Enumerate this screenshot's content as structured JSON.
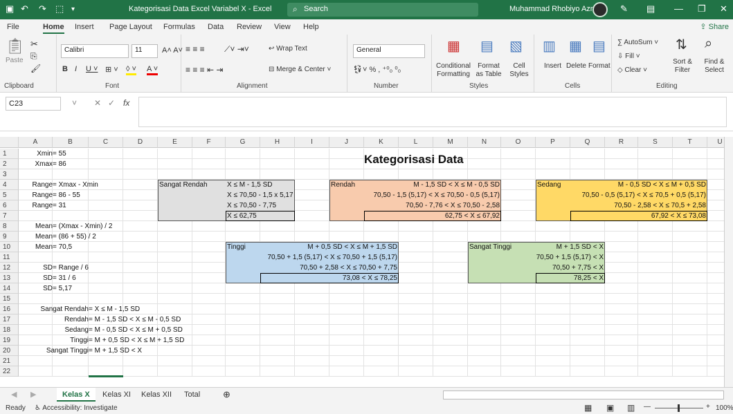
{
  "titlebar": {
    "title": "Kategorisasi Data Excel Variabel X  -  Excel",
    "search_placeholder": "Search",
    "user": "Muhammad Rhobiyo Azmi"
  },
  "menu_tabs": [
    "File",
    "Home",
    "Insert",
    "Page Layout",
    "Formulas",
    "Data",
    "Review",
    "View",
    "Help"
  ],
  "share_label": "Share",
  "ribbon": {
    "clipboard": {
      "label": "Clipboard",
      "paste": "Paste"
    },
    "font": {
      "label": "Font",
      "name": "Calibri",
      "size": "11"
    },
    "alignment": {
      "label": "Alignment",
      "wrap": "Wrap Text",
      "merge": "Merge & Center"
    },
    "number": {
      "label": "Number",
      "format": "General"
    },
    "styles": {
      "label": "Styles",
      "conditional": "Conditional Formatting",
      "format_table": "Format as Table",
      "cell_styles": "Cell Styles"
    },
    "cells": {
      "label": "Cells",
      "insert": "Insert",
      "delete": "Delete",
      "format": "Format"
    },
    "editing": {
      "label": "Editing",
      "autosum": "AutoSum",
      "fill": "Fill",
      "clear": "Clear",
      "sort": "Sort & Filter",
      "find": "Find & Select"
    }
  },
  "name_box": "C23",
  "columns": [
    "A",
    "B",
    "C",
    "D",
    "E",
    "F",
    "G",
    "H",
    "I",
    "J",
    "K",
    "L",
    "M",
    "N",
    "O",
    "P",
    "Q",
    "R",
    "S",
    "T",
    "U"
  ],
  "rows": [
    "1",
    "2",
    "3",
    "4",
    "5",
    "6",
    "7",
    "8",
    "9",
    "10",
    "11",
    "12",
    "13",
    "14",
    "15",
    "16",
    "17",
    "18",
    "19",
    "20",
    "21",
    "22"
  ],
  "cells": {
    "a1": "Xmin = 55",
    "a2": "Xmax = 86",
    "a4": "Range = Xmax - Xmin",
    "a5": "Range = 86 - 55",
    "a6": "Range = 31",
    "a8": "Mean = (Xmax - Xmin) / 2",
    "a9": "Mean = (86 + 55) / 2",
    "a10": "Mean = 70,5",
    "a12": "SD = Range / 6",
    "a13": "SD = 31 / 6",
    "a14": "SD = 5,17",
    "a16": "Sangat Rendah = X ≤ M - 1,5 SD",
    "a17": "Rendah = M - 1,5 SD < X ≤ M - 0,5 SD",
    "a18": "Sedang = M - 0,5 SD < X ≤ M + 0,5 SD",
    "a19": "Tinggi = M + 0,5 SD < X ≤ M + 1,5 SD",
    "a20": "Sangat Tinggi = M + 1,5 SD < X",
    "title": "Kategorisasi Data",
    "sr_label": "Sangat Rendah",
    "sr1": "X ≤ M - 1,5 SD",
    "sr2": "X ≤ 70,50 - 1,5 x 5,17",
    "sr3": "X ≤ 70,50 - 7,75",
    "sr4": "X ≤ 62,75",
    "r_label": "Rendah",
    "r1": "M - 1,5 SD <  X  ≤ M - 0,5 SD",
    "r2": "70,50 - 1,5 (5,17) <  X  ≤ 70,50 - 0,5 (5,17)",
    "r3": "70,50 - 7,76 <  X  ≤ 70,50 - 2,58",
    "r4": "62,75 <  X  ≤ 67,92",
    "s_label": "Sedang",
    "s1": "M - 0,5 SD <  X  ≤ M + 0,5 SD",
    "s2": "70,50 - 0,5 (5,17) <  X  ≤ 70,5 + 0,5 (5,17)",
    "s3": "70,50 - 2,58 <  X  ≤ 70,5 + 2,58",
    "s4": "67,92 <  X  ≤ 73,08",
    "t_label": "Tinggi",
    "t1": "M + 0,5 SD <  X  ≤ M + 1,5 SD",
    "t2": "70,50 + 1,5 (5,17) <  X  ≤ 70,50 + 1,5 (5,17)",
    "t3": "70,50 + 2,58 <  X  ≤ 70,50 + 7,75",
    "t4": "73,08 <  X  ≤ 78,25",
    "st_label": "Sangat Tinggi",
    "st1": "M + 1,5 SD < X",
    "st2": "70,50 + 1,5 (5,17) < X",
    "st3": "70,50 + 7,75 < X",
    "st4": "78,25 < X"
  },
  "colors": {
    "sangat_rendah": "#e0e0e0",
    "rendah": "#f8cbad",
    "sedang": "#ffd966",
    "tinggi": "#bdd7ee",
    "sangat_tinggi": "#c6e0b4",
    "excel_green": "#217346"
  },
  "sheets": [
    "Kelas X",
    "Kelas XI",
    "Kelas XII",
    "Total"
  ],
  "status": {
    "ready": "Ready",
    "accessibility": "Accessibility: Investigate",
    "zoom": "100%"
  }
}
